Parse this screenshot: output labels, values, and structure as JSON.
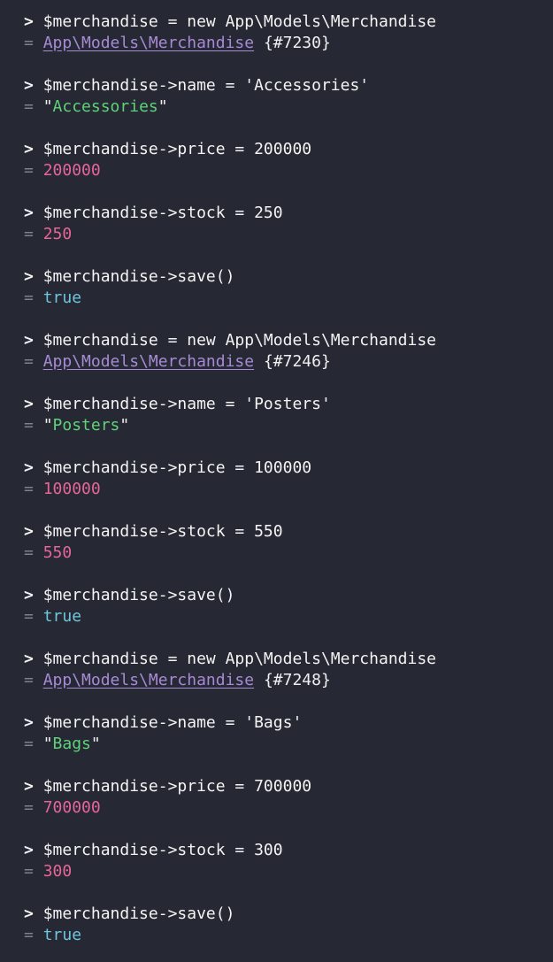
{
  "prompt_symbol": ">",
  "result_symbol": "=",
  "entries": [
    {
      "cmd": "$merchandise = new App\\Models\\Merchandise",
      "result": {
        "type": "object",
        "class_link": "App\\Models\\Merchandise",
        "id": "{#7230}"
      }
    },
    {
      "cmd": "$merchandise->name = 'Accessories'",
      "result": {
        "type": "string",
        "value": "Accessories"
      }
    },
    {
      "cmd": "$merchandise->price = 200000",
      "result": {
        "type": "number",
        "value": "200000"
      }
    },
    {
      "cmd": "$merchandise->stock = 250",
      "result": {
        "type": "number",
        "value": "250"
      }
    },
    {
      "cmd": "$merchandise->save()",
      "result": {
        "type": "bool",
        "value": "true"
      }
    },
    {
      "cmd": "$merchandise = new App\\Models\\Merchandise",
      "result": {
        "type": "object",
        "class_link": "App\\Models\\Merchandise",
        "id": "{#7246}"
      }
    },
    {
      "cmd": "$merchandise->name = 'Posters'",
      "result": {
        "type": "string",
        "value": "Posters"
      }
    },
    {
      "cmd": "$merchandise->price = 100000",
      "result": {
        "type": "number",
        "value": "100000"
      }
    },
    {
      "cmd": "$merchandise->stock = 550",
      "result": {
        "type": "number",
        "value": "550"
      }
    },
    {
      "cmd": "$merchandise->save()",
      "result": {
        "type": "bool",
        "value": "true"
      }
    },
    {
      "cmd": "$merchandise = new App\\Models\\Merchandise",
      "result": {
        "type": "object",
        "class_link": "App\\Models\\Merchandise",
        "id": "{#7248}"
      }
    },
    {
      "cmd": "$merchandise->name = 'Bags'",
      "result": {
        "type": "string",
        "value": "Bags"
      }
    },
    {
      "cmd": "$merchandise->price = 700000",
      "result": {
        "type": "number",
        "value": "700000"
      }
    },
    {
      "cmd": "$merchandise->stock = 300",
      "result": {
        "type": "number",
        "value": "300"
      }
    },
    {
      "cmd": "$merchandise->save()",
      "result": {
        "type": "bool",
        "value": "true"
      }
    }
  ],
  "colors": {
    "background": "#262833",
    "command": "#f4f4f4",
    "result_marker": "#7d8190",
    "class_link": "#a88bd6",
    "string": "#5fd27a",
    "number": "#e6669a",
    "boolean": "#6fc6dd"
  }
}
